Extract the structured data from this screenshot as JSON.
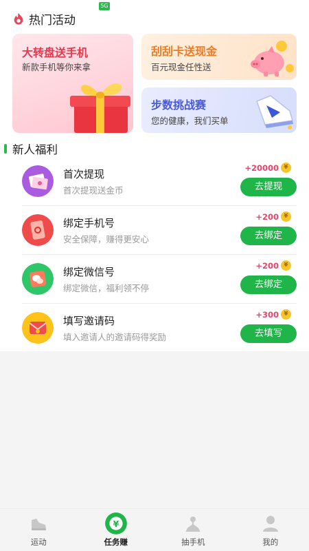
{
  "hot": {
    "title": "热门活动"
  },
  "banners": [
    {
      "title": "大转盘送手机",
      "subtitle": "新款手机等你来拿"
    },
    {
      "title": "刮刮卡送现金",
      "subtitle": "百元现金任性送"
    },
    {
      "title": "步数挑战赛",
      "subtitle": "您的健康，我们买单"
    }
  ],
  "welfare": {
    "title": "新人福利",
    "tasks": [
      {
        "title": "首次提现",
        "subtitle": "首次提现送金币",
        "reward": "+20000",
        "button": "去提现",
        "icon": "cash-card-icon"
      },
      {
        "title": "绑定手机号",
        "subtitle": "安全保障，赚得更安心",
        "reward": "+200",
        "button": "去绑定",
        "icon": "phone-icon"
      },
      {
        "title": "绑定微信号",
        "subtitle": "绑定微信，福利领不停",
        "reward": "+200",
        "button": "去绑定",
        "icon": "wechat-icon"
      },
      {
        "title": "填写邀请码",
        "subtitle": "填入邀请人的邀请码得奖励",
        "reward": "+300",
        "button": "去填写",
        "icon": "invite-envelope-icon"
      }
    ]
  },
  "coin_symbol": "¥",
  "status_badge": "5G",
  "tabbar": {
    "items": [
      {
        "label": "运动",
        "icon": "shoe-icon"
      },
      {
        "label": "任务赚",
        "icon": "yen-coin-icon"
      },
      {
        "label": "抽手机",
        "icon": "claw-icon"
      },
      {
        "label": "我的",
        "icon": "user-icon"
      }
    ]
  },
  "colors": {
    "accent_green": "#1fb548",
    "reward_pink": "#e8456b",
    "coin_gold": "#f7c42a"
  }
}
